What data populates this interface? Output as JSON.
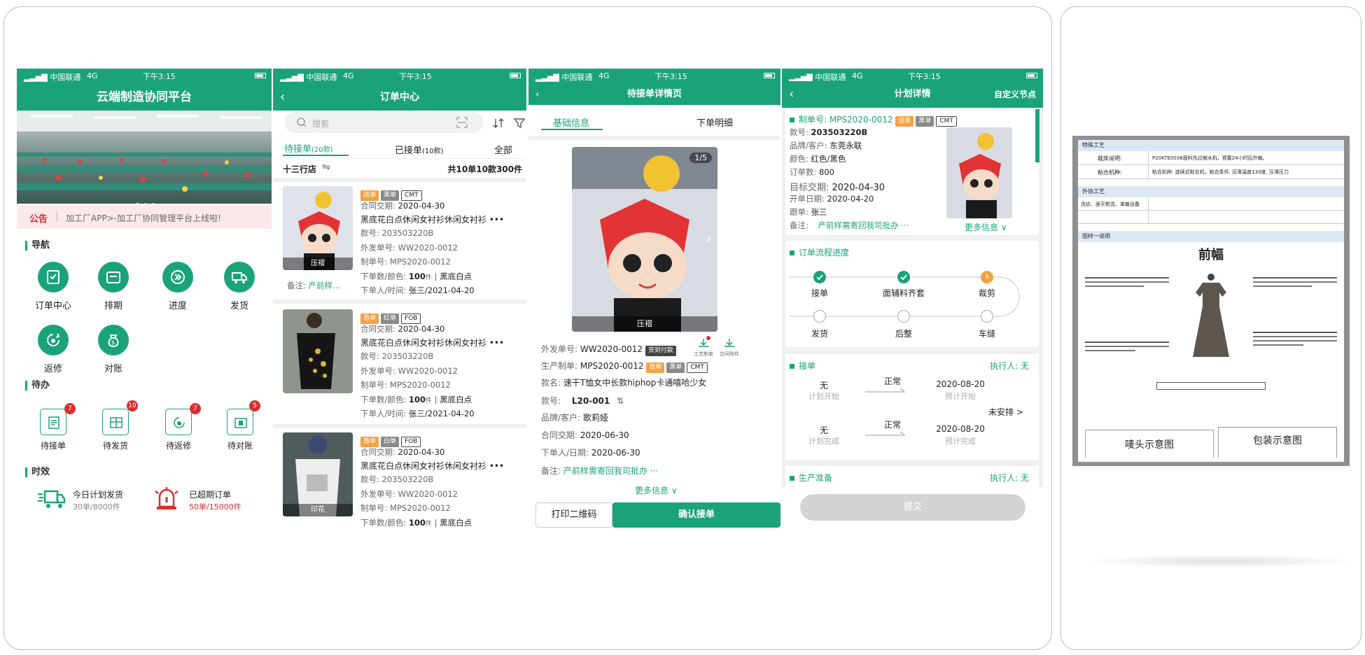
{
  "status_bar": {
    "carrier": "中国联通",
    "network": "4G",
    "time": "下午3:15"
  },
  "p1": {
    "title": "云端制造协同平台",
    "notice_label": "公告",
    "notice_text": "加工厂APP>-加工厂协同管理平台上线啦!",
    "nav_title": "导航",
    "nav": [
      {
        "label": "订单中心",
        "icon": "clipboard-icon"
      },
      {
        "label": "排期",
        "icon": "calendar-icon"
      },
      {
        "label": "进度",
        "icon": "progress-icon"
      },
      {
        "label": "发货",
        "icon": "truck-icon"
      },
      {
        "label": "返修",
        "icon": "repair-icon"
      },
      {
        "label": "对账",
        "icon": "money-bag-icon"
      }
    ],
    "todo_title": "待办",
    "todo": [
      {
        "label": "待接单",
        "count": "7"
      },
      {
        "label": "待发货",
        "count": "10"
      },
      {
        "label": "待返修",
        "count": "7"
      },
      {
        "label": "待对账",
        "count": "5"
      }
    ],
    "eff_title": "时效",
    "eff": [
      {
        "label": "今日计划发货",
        "value": "30单/8000件"
      },
      {
        "label": "已超期订单",
        "value": "50单/15000件"
      }
    ]
  },
  "p2": {
    "title": "订单中心",
    "search_placeholder": "搜索",
    "tabs": [
      {
        "label": "待接单",
        "count": "(20款)"
      },
      {
        "label": "已接单",
        "count": "(10款)"
      },
      {
        "label": "全部",
        "count": ""
      }
    ],
    "store": "十三行店",
    "summary": "共10单10款300件",
    "orders": [
      {
        "tags": [
          "改单",
          "黑单",
          "CMT"
        ],
        "date_label": "合同交期:",
        "date": "2020-04-30",
        "name": "黑底花白点休闲女衬衫休闲女衬衫",
        "style_label": "款号:",
        "style": "203503220B",
        "out_label": "外发单号:",
        "out": "WW2020-0012",
        "mps_label": "制单号:",
        "mps": "MPS2020-0012",
        "qty_label": "下单数/颜色:",
        "qty": "100",
        "unit": "件",
        "color": "黑底白点",
        "user_label": "下单人/时间:",
        "user": "张三/2021-04-20",
        "note_label": "备注:",
        "note": "产前样...",
        "thumb_label": "压褶"
      },
      {
        "tags": [
          "首单",
          "红单",
          "FOB"
        ],
        "date_label": "合同交期:",
        "date": "2020-04-30",
        "name": "黑底花白点休闲女衬衫休闲女衬衫",
        "style_label": "款号:",
        "style": "203503220B",
        "out_label": "外发单号:",
        "out": "WW2020-0012",
        "mps_label": "制单号:",
        "mps": "MPS2020-0012",
        "qty_label": "下单数/颜色:",
        "qty": "100",
        "unit": "件",
        "color": "黑底白点",
        "user_label": "下单人/时间:",
        "user": "张三/2021-04-20",
        "note_label": "",
        "note": "",
        "thumb_label": ""
      },
      {
        "tags": [
          "首单",
          "白单",
          "FOB"
        ],
        "date_label": "合同交期:",
        "date": "2020-04-30",
        "name": "黑底花白点休闲女衬衫休闲女衬衫",
        "style_label": "款号:",
        "style": "203503220B",
        "out_label": "外发单号:",
        "out": "WW2020-0012",
        "mps_label": "制单号:",
        "mps": "MPS2020-0012",
        "qty_label": "下单数/颜色:",
        "qty": "100",
        "unit": "件",
        "color": "黑底白点",
        "user_label": "",
        "user": "",
        "note_label": "",
        "note": "",
        "thumb_label": "印花"
      }
    ]
  },
  "p3": {
    "title": "待接单详情页",
    "tabs": [
      "基础信息",
      "下单明细"
    ],
    "img_counter": "1/5",
    "img_label": "压褶",
    "out_label": "外发单号:",
    "out": "WW2020-0012",
    "out_badge": "货到付款",
    "mini": [
      "工艺制单",
      "合同附件"
    ],
    "mps_label": "生产制单:",
    "mps": "MPS2020-0012",
    "tags": [
      "改单",
      "黑单",
      "CMT"
    ],
    "name_label": "款名:",
    "name": "速干T恤女中长款hiphop卡通嘻哈少女",
    "style_label": "款号:",
    "style": "L20-001",
    "brand_label": "品牌/客户:",
    "brand": "歌莉娅",
    "date_label": "合同交期:",
    "date": "2020-06-30",
    "user_label": "下单人/日期:",
    "user_date": "2020-06-30",
    "note_label": "备注:",
    "note": "产前样需寄回我司批办 ···",
    "more": "更多信息 ∨",
    "btn_print": "打印二维码",
    "btn_confirm": "确认接单"
  },
  "p4": {
    "title": "计划详情",
    "custom": "自定义节点",
    "mps_label": "制单号:",
    "mps": "MPS2020-0012",
    "tags": [
      "返单",
      "黑单",
      "CMT"
    ],
    "fields": [
      {
        "label": "款号:",
        "value": "203503220B"
      },
      {
        "label": "品牌/客户:",
        "value": "东莞永联"
      },
      {
        "label": "颜色:",
        "value": "红色/黑色"
      },
      {
        "label": "订单数:",
        "value": "800"
      },
      {
        "label": "目标交期:",
        "value": "2020-04-30"
      },
      {
        "label": "开单日期:",
        "value": "2020-04-20"
      },
      {
        "label": "跟单:",
        "value": "张三"
      }
    ],
    "note_label": "备注:",
    "note": "产前样需寄回我司批办 ···",
    "more": "更多信息 ∨",
    "flow_title": "订单流程进度",
    "flow": [
      "接单",
      "面辅料齐套",
      "裁剪",
      "发货",
      "后整",
      "车缝"
    ],
    "sec1": {
      "title": "接单",
      "exec": "执行人: 无",
      "r1": {
        "left": "无",
        "left_sub": "计划开始",
        "mid": "正常",
        "right": "2020-08-20",
        "right_sub": "预计开始"
      },
      "r2": {
        "left": "无",
        "left_sub": "计划完成",
        "mid": "正常",
        "right": "2020-08-20",
        "right_sub": "预计完成"
      },
      "unarranged": "未安排 >"
    },
    "sec2": {
      "title": "生产准备",
      "exec": "执行人: 无"
    },
    "submit": "提交"
  },
  "doc": {
    "s1": "特殊工艺",
    "r1a": "裁床说明:",
    "r1b": "P20KTE0036面料先过缩水机，预置24小时后外裁。",
    "r2a": "粘合机种:",
    "r2b": "粘合机种: 连续式粘合机，粘合条件: 压滑温度130度, 压滑压力",
    "s2": "外协工艺",
    "r3a": "洗坊、面平熨烫、单裁设备",
    "s3": "图样一说明",
    "front": "前幅",
    "btm1": "唛头示意图",
    "btm2": "包装示意图"
  }
}
